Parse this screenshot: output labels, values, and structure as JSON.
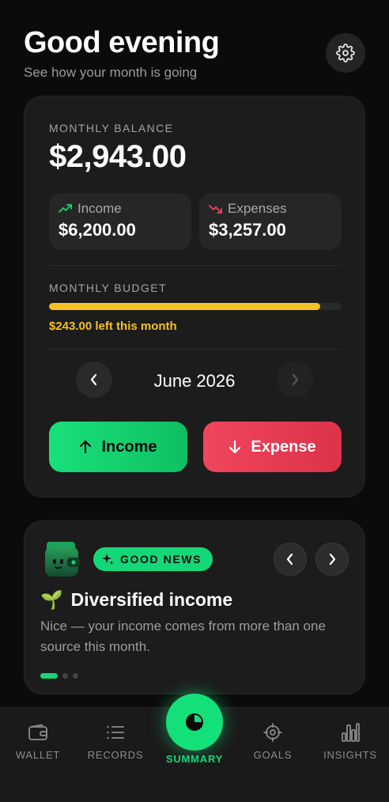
{
  "header": {
    "greeting": "Good evening",
    "subtitle": "See how your month is going",
    "settings_icon": "gear-icon"
  },
  "balance": {
    "label": "MONTHLY BALANCE",
    "amount": "$2,943.00",
    "income": {
      "label": "Income",
      "value": "$6,200.00",
      "icon": "trend-up-icon",
      "color": "#19d478"
    },
    "expenses": {
      "label": "Expenses",
      "value": "$3,257.00",
      "icon": "trend-down-icon",
      "color": "#f0455e"
    }
  },
  "budget": {
    "label": "MONTHLY BUDGET",
    "progress": 0.927,
    "left_text": "$243.00 left this month",
    "color": "#f6c026"
  },
  "month_nav": {
    "month": "June 2026",
    "next_disabled": true
  },
  "actions": {
    "income_label": "Income",
    "expense_label": "Expense"
  },
  "news": {
    "badge": "GOOD NEWS",
    "title": "Diversified income",
    "title_emoji": "🌱",
    "body": "Nice — your income comes from more than one source this month.",
    "page_count": 3,
    "active_page": 0,
    "accent": "#14d878"
  },
  "tabbar": {
    "tabs": [
      {
        "label": "WALLET",
        "icon": "wallet-icon"
      },
      {
        "label": "RECORDS",
        "icon": "list-icon"
      },
      {
        "label": "SUMMARY",
        "icon": "pie-chart-icon",
        "active": true
      },
      {
        "label": "GOALS",
        "icon": "target-icon"
      },
      {
        "label": "INSIGHTS",
        "icon": "bar-chart-icon"
      }
    ]
  }
}
